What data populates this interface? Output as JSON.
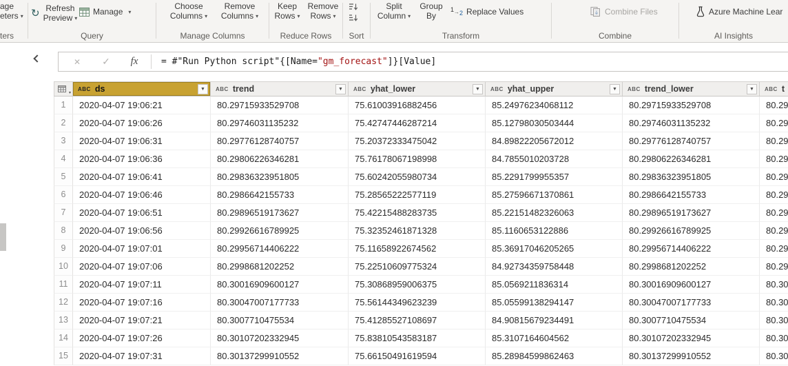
{
  "colors": {
    "selected_header": "#c8a232",
    "string_literal": "#a31515"
  },
  "icons": {
    "refresh": "↻",
    "dropdown": "▾",
    "filter": "▼",
    "close": "✕",
    "check": "✓",
    "fx": "fx"
  },
  "ribbon": {
    "cut_group": {
      "line1": "age",
      "line2": "eters",
      "label": "ters"
    },
    "query": {
      "refresh": {
        "line1": "Refresh",
        "line2": "Preview"
      },
      "manage": "Manage",
      "label": "Query"
    },
    "manage_columns": {
      "choose": {
        "line1": "Choose",
        "line2": "Columns"
      },
      "remove": {
        "line1": "Remove",
        "line2": "Columns"
      },
      "label": "Manage Columns"
    },
    "reduce_rows": {
      "keep": {
        "line1": "Keep",
        "line2": "Rows"
      },
      "remove": {
        "line1": "Remove",
        "line2": "Rows"
      },
      "label": "Reduce Rows"
    },
    "sort": {
      "label": "Sort"
    },
    "transform": {
      "split": {
        "line1": "Split",
        "line2": "Column"
      },
      "group_by": {
        "line1": "Group",
        "line2": "By"
      },
      "replace_values": "Replace Values",
      "label": "Transform"
    },
    "combine": {
      "combine_files": "Combine Files",
      "label": "Combine"
    },
    "ai_insights": {
      "azure_ml": "Azure Machine Lear",
      "label": "AI Insights"
    }
  },
  "formula_bar": {
    "formula": {
      "prefix": "= #\"Run Python script\"{[Name=",
      "string_literal": "\"gm_forecast\"",
      "suffix": "]}[Value]"
    }
  },
  "table": {
    "type_badge": "ABC",
    "columns": [
      {
        "name": "ds"
      },
      {
        "name": "trend"
      },
      {
        "name": "yhat_lower"
      },
      {
        "name": "yhat_upper"
      },
      {
        "name": "trend_lower"
      },
      {
        "name": "t"
      }
    ],
    "rows": [
      {
        "n": 1,
        "ds": "2020-04-07 19:06:21",
        "trend": "80.29715933529708",
        "yhat_lower": "75.61003916882456",
        "yhat_upper": "85.24976234068112",
        "trend_lower": "80.29715933529708",
        "t": "80.29"
      },
      {
        "n": 2,
        "ds": "2020-04-07 19:06:26",
        "trend": "80.29746031135232",
        "yhat_lower": "75.42747446287214",
        "yhat_upper": "85.12798030503444",
        "trend_lower": "80.29746031135232",
        "t": "80.29"
      },
      {
        "n": 3,
        "ds": "2020-04-07 19:06:31",
        "trend": "80.29776128740757",
        "yhat_lower": "75.20372333475042",
        "yhat_upper": "84.89822205672012",
        "trend_lower": "80.29776128740757",
        "t": "80.29"
      },
      {
        "n": 4,
        "ds": "2020-04-07 19:06:36",
        "trend": "80.29806226346281",
        "yhat_lower": "75.76178067198998",
        "yhat_upper": "84.7855010203728",
        "trend_lower": "80.29806226346281",
        "t": "80.29"
      },
      {
        "n": 5,
        "ds": "2020-04-07 19:06:41",
        "trend": "80.29836323951805",
        "yhat_lower": "75.60242055980734",
        "yhat_upper": "85.2291799955357",
        "trend_lower": "80.29836323951805",
        "t": "80.29"
      },
      {
        "n": 6,
        "ds": "2020-04-07 19:06:46",
        "trend": "80.2986642155733",
        "yhat_lower": "75.28565222577119",
        "yhat_upper": "85.27596671370861",
        "trend_lower": "80.2986642155733",
        "t": "80.29"
      },
      {
        "n": 7,
        "ds": "2020-04-07 19:06:51",
        "trend": "80.29896519173627",
        "yhat_lower": "75.42215488283735",
        "yhat_upper": "85.22151482326063",
        "trend_lower": "80.29896519173627",
        "t": "80.29"
      },
      {
        "n": 8,
        "ds": "2020-04-07 19:06:56",
        "trend": "80.29926616789925",
        "yhat_lower": "75.32352461871328",
        "yhat_upper": "85.1160653122886",
        "trend_lower": "80.29926616789925",
        "t": "80.29"
      },
      {
        "n": 9,
        "ds": "2020-04-07 19:07:01",
        "trend": "80.29956714406222",
        "yhat_lower": "75.11658922674562",
        "yhat_upper": "85.36917046205265",
        "trend_lower": "80.29956714406222",
        "t": "80.29"
      },
      {
        "n": 10,
        "ds": "2020-04-07 19:07:06",
        "trend": "80.2998681202252",
        "yhat_lower": "75.22510609775324",
        "yhat_upper": "84.92734359758448",
        "trend_lower": "80.2998681202252",
        "t": "80.29"
      },
      {
        "n": 11,
        "ds": "2020-04-07 19:07:11",
        "trend": "80.30016909600127",
        "yhat_lower": "75.30868959006375",
        "yhat_upper": "85.0569211836314",
        "trend_lower": "80.30016909600127",
        "t": "80.30"
      },
      {
        "n": 12,
        "ds": "2020-04-07 19:07:16",
        "trend": "80.30047007177733",
        "yhat_lower": "75.56144349623239",
        "yhat_upper": "85.05599138294147",
        "trend_lower": "80.30047007177733",
        "t": "80.30"
      },
      {
        "n": 13,
        "ds": "2020-04-07 19:07:21",
        "trend": "80.3007710475534",
        "yhat_lower": "75.41285527108697",
        "yhat_upper": "84.90815679234491",
        "trend_lower": "80.3007710475534",
        "t": "80.30"
      },
      {
        "n": 14,
        "ds": "2020-04-07 19:07:26",
        "trend": "80.30107202332945",
        "yhat_lower": "75.83810543583187",
        "yhat_upper": "85.3107164604562",
        "trend_lower": "80.30107202332945",
        "t": "80.30"
      },
      {
        "n": 15,
        "ds": "2020-04-07 19:07:31",
        "trend": "80.30137299910552",
        "yhat_lower": "75.66150491619594",
        "yhat_upper": "85.28984599862463",
        "trend_lower": "80.30137299910552",
        "t": "80.30"
      }
    ]
  }
}
